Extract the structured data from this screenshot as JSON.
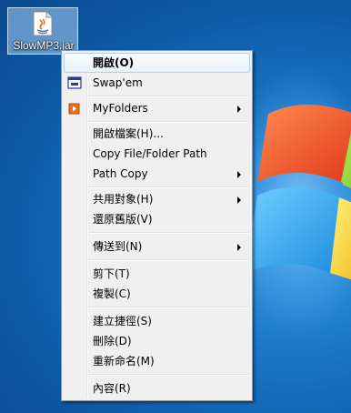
{
  "desktop": {
    "icon_label": "SlowMP3.jar"
  },
  "menu": {
    "items": [
      {
        "label": "開啟(O)",
        "selected": true
      },
      {
        "label": "Swap'em",
        "icon": "swapem-icon"
      },
      {
        "label": "MyFolders",
        "icon": "myfolders-icon",
        "submenu": true
      },
      {
        "label": "開啟檔案(H)..."
      },
      {
        "label": "Copy File/Folder Path"
      },
      {
        "label": "Path Copy",
        "submenu": true
      },
      {
        "label": "共用對象(H)",
        "submenu": true
      },
      {
        "label": "還原舊版(V)"
      },
      {
        "label": "傳送到(N)",
        "submenu": true
      },
      {
        "label": "剪下(T)"
      },
      {
        "label": "複製(C)"
      },
      {
        "label": "建立捷徑(S)"
      },
      {
        "label": "刪除(D)"
      },
      {
        "label": "重新命名(M)"
      },
      {
        "label": "內容(R)"
      }
    ]
  },
  "colors": {
    "desktop_blue": "#1a76c8",
    "menu_bg": "#f0f0f0",
    "selection_border": "#aecff7"
  }
}
